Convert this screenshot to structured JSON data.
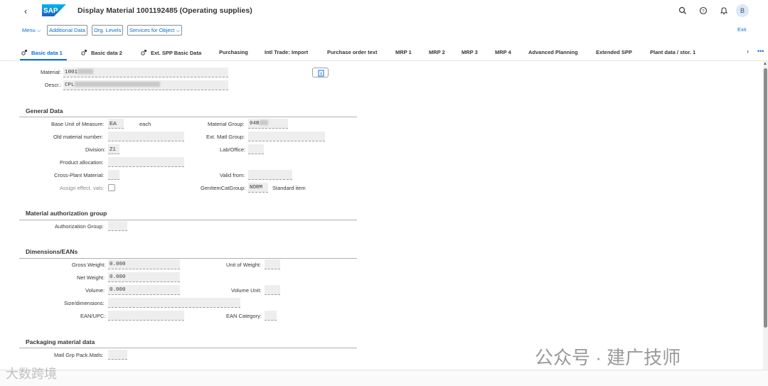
{
  "shell": {
    "back_icon": "chevron-left-icon",
    "logo_text": "SAP",
    "title": "Display Material 1001192485 (Operating supplies)",
    "avatar_initial": "B",
    "icons": [
      "search-icon",
      "help-icon",
      "bell-icon"
    ]
  },
  "toolbar": {
    "menu": "Menu",
    "additional_data": "Additional Data",
    "org_levels": "Org. Levels",
    "services": "Services for Object",
    "exit": "Exit"
  },
  "tabs": [
    "Basic data 1",
    "Basic data 2",
    "Ext. SPP Basic Data",
    "Purchasing",
    "Intl Trade: Import",
    "Purchase order text",
    "MRP 1",
    "MRP 2",
    "MRP 3",
    "MRP 4",
    "Advanced Planning",
    "Extended SPP",
    "Plant data / stor. 1"
  ],
  "header_fields": {
    "material_label": "Material:",
    "material_value": "1001",
    "descr_label": "Descr.:",
    "descr_value": "CPL"
  },
  "general": {
    "title": "General Data",
    "base_uom_label": "Base Unit of Measure:",
    "base_uom_value": "EA",
    "base_uom_text": "each",
    "material_group_label": "Material Group:",
    "material_group_value": "04B",
    "old_material_label": "Old material number:",
    "ext_matl_group_label": "Ext. Matl Group:",
    "division_label": "Division:",
    "division_value": "Z1",
    "lab_office_label": "Lab/Office:",
    "product_alloc_label": "Product allocation:",
    "cross_plant_label": "Cross-Plant Material:",
    "valid_from_label": "Valid from:",
    "assign_effect_label": "Assign effect. vals:",
    "gen_item_cat_label": "GenItemCatGroup:",
    "gen_item_cat_value": "NORM",
    "gen_item_cat_text": "Standard item"
  },
  "auth": {
    "title": "Material authorization group",
    "auth_group_label": "Authorization Group:"
  },
  "dimensions": {
    "title": "Dimensions/EANs",
    "gross_weight_label": "Gross Weight:",
    "gross_weight_value": "0.000",
    "unit_weight_label": "Unit of Weight:",
    "net_weight_label": "Net Weight:",
    "net_weight_value": "0.000",
    "volume_label": "Volume:",
    "volume_value": "0.000",
    "volume_unit_label": "Volume Unit:",
    "size_dim_label": "Size/dimensions:",
    "ean_upc_label": "EAN/UPC:",
    "ean_category_label": "EAN Category:"
  },
  "packaging": {
    "title": "Packaging material data",
    "matl_grp_pack_label": "Matl Grp Pack.Matls:"
  },
  "watermark": {
    "right": "公众号 · 建广技师",
    "left": "大数跨境"
  },
  "colors": {
    "accent": "#0a6ed1",
    "field_bg": "#eeeeee",
    "text": "#32363a"
  }
}
